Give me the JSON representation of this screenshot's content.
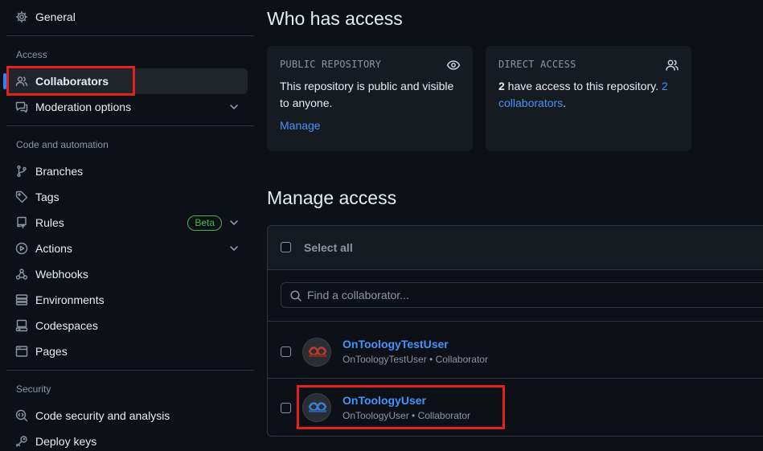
{
  "sidebar": {
    "general": "General",
    "sections": {
      "access": "Access",
      "code_automation": "Code and automation",
      "security": "Security"
    },
    "access_items": [
      {
        "label": "Collaborators",
        "icon": "people-icon",
        "active": true
      },
      {
        "label": "Moderation options",
        "icon": "report-icon",
        "expandable": true
      }
    ],
    "code_items": [
      {
        "label": "Branches",
        "icon": "git-branch-icon"
      },
      {
        "label": "Tags",
        "icon": "tag-icon"
      },
      {
        "label": "Rules",
        "icon": "repo-push-icon",
        "badge": "Beta",
        "expandable": true
      },
      {
        "label": "Actions",
        "icon": "play-icon",
        "expandable": true
      },
      {
        "label": "Webhooks",
        "icon": "webhook-icon"
      },
      {
        "label": "Environments",
        "icon": "server-icon"
      },
      {
        "label": "Codespaces",
        "icon": "codespaces-icon"
      },
      {
        "label": "Pages",
        "icon": "browser-icon"
      }
    ],
    "security_items": [
      {
        "label": "Code security and analysis",
        "icon": "codescan-icon"
      },
      {
        "label": "Deploy keys",
        "icon": "key-icon"
      }
    ]
  },
  "main": {
    "who_has_access_title": "Who has access",
    "public_card": {
      "title": "PUBLIC REPOSITORY",
      "body": "This repository is public and visible to anyone.",
      "link": "Manage"
    },
    "direct_card": {
      "title": "DIRECT ACCESS",
      "count": "2",
      "body": " have access to this repository. ",
      "link": "2 collaborators",
      "period": "."
    },
    "manage_access_title": "Manage access",
    "select_all": "Select all",
    "search_placeholder": "Find a collaborator...",
    "collaborators": [
      {
        "name": "OnToologyTestUser",
        "meta": "OnToologyTestUser • Collaborator"
      },
      {
        "name": "OnToologyUser",
        "meta": "OnToologyUser • Collaborator"
      }
    ]
  },
  "colors": {
    "background": "#0d1117",
    "card": "#161b22",
    "link": "#4493f8",
    "beta": "#3fb950",
    "highlight": "#e3231b",
    "active_indicator": "#2f81f7"
  }
}
